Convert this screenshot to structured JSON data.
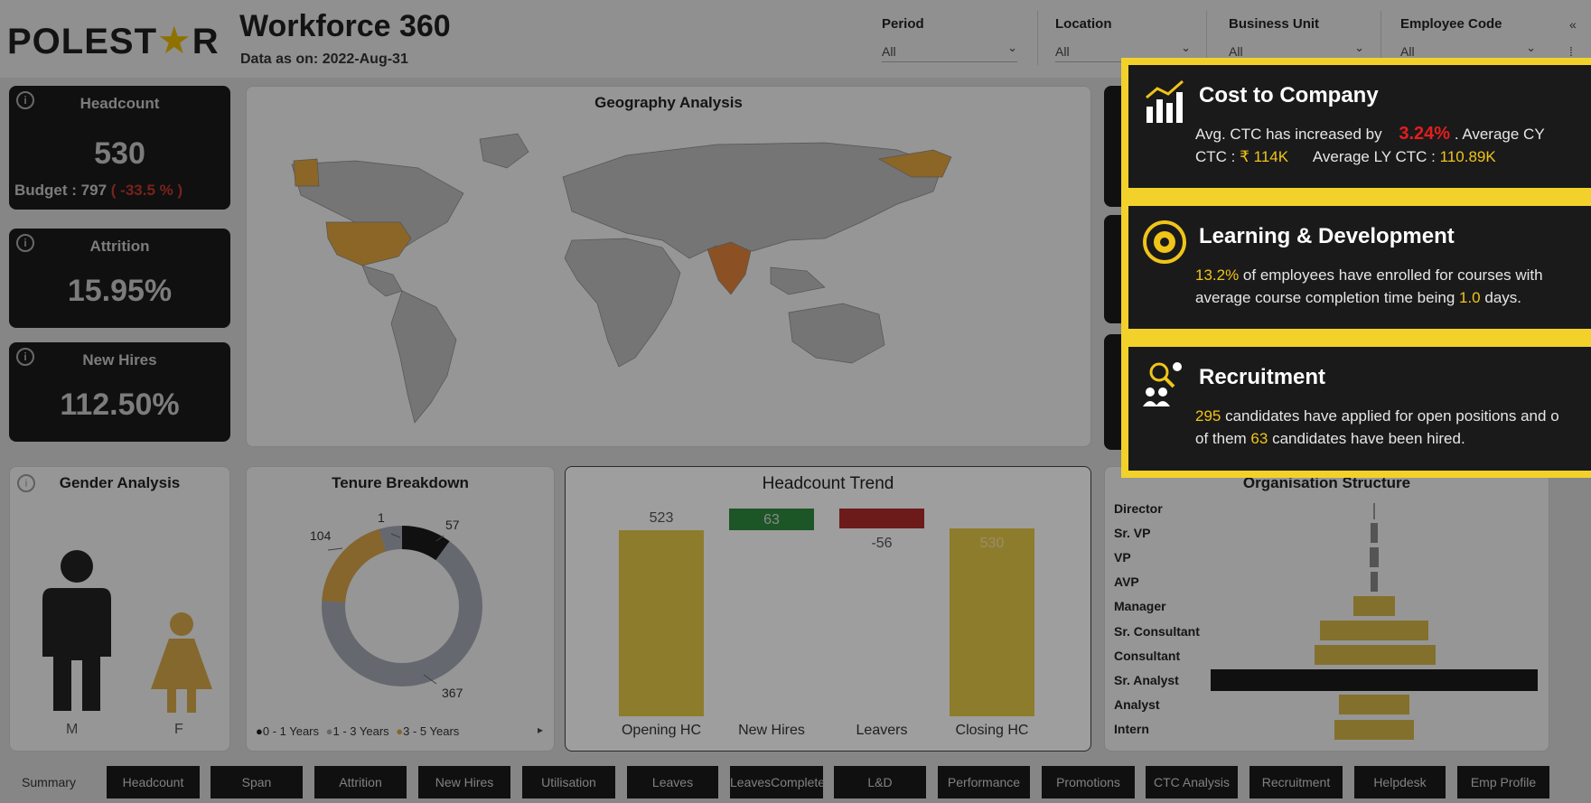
{
  "header": {
    "logo": "POLESTAR",
    "title": "Workforce 360",
    "data_as_on": "Data as on: 2022-Aug-31",
    "slicers": [
      {
        "label": "Period",
        "value": "All"
      },
      {
        "label": "Location",
        "value": "All"
      },
      {
        "label": "Business Unit",
        "value": "All"
      },
      {
        "label": "Employee Code",
        "value": "All"
      }
    ]
  },
  "kpis": {
    "headcount": {
      "title": "Headcount",
      "value": "530",
      "budget_label": "Budget :",
      "budget_value": "797",
      "budget_delta": "( -33.5 % )"
    },
    "attrition": {
      "title": "Attrition",
      "value": "15.95%"
    },
    "new_hires": {
      "title": "New Hires",
      "value": "112.50%"
    }
  },
  "geography": {
    "title": "Geography Analysis"
  },
  "gender": {
    "title": "Gender Analysis",
    "male": "M",
    "female": "F"
  },
  "tenure": {
    "title": "Tenure Breakdown",
    "labels": [
      "1",
      "57",
      "104",
      "367"
    ],
    "legend": [
      "0 - 1 Years",
      "1 - 3 Years",
      "3 - 5 Years"
    ]
  },
  "trend": {
    "title": "Headcount Trend",
    "bars": [
      {
        "label": "Opening HC",
        "value": "523"
      },
      {
        "label": "New Hires",
        "value": "63"
      },
      {
        "label": "Leavers",
        "value": "-56"
      },
      {
        "label": "Closing HC",
        "value": "530"
      }
    ]
  },
  "org": {
    "title": "Organisation Structure",
    "levels": [
      "Director",
      "Sr. VP",
      "VP",
      "AVP",
      "Manager",
      "Sr. Consultant",
      "Consultant",
      "Sr. Analyst",
      "Analyst",
      "Intern"
    ]
  },
  "popup": {
    "ctc": {
      "title": "Cost to Company",
      "t1": "Avg. CTC has increased by",
      "pct": "3.24%",
      "t2": ". Average CY",
      "t3": "CTC :",
      "cy": "₹ 114K",
      "t4": "Average LY CTC :",
      "ly": "110.89K"
    },
    "ld": {
      "title": "Learning & Development",
      "pct": "13.2%",
      "t1": " of employees have enrolled for courses with average course completion time being ",
      "days": "1.0",
      "t2": " days."
    },
    "rec": {
      "title": "Recruitment",
      "applied": "295",
      "t1": " candidates have applied for open positions and o",
      "t2": "of them ",
      "hired": "63",
      "t3": " candidates have been hired."
    }
  },
  "tabs": [
    "Summary",
    "Headcount",
    "Span",
    "Attrition",
    "New Hires",
    "Utilisation",
    "Leaves",
    "LeavesComplete",
    "L&D",
    "Performance",
    "Promotions",
    "CTC Analysis",
    "Recruitment",
    "Helpdesk",
    "Emp Profile"
  ],
  "colors": {
    "accent_yellow": "#f2d12b",
    "bar_gold": "#e5c84a",
    "green": "#2e8b3e",
    "red": "#b02a2a",
    "dark": "#1b1b1b"
  }
}
